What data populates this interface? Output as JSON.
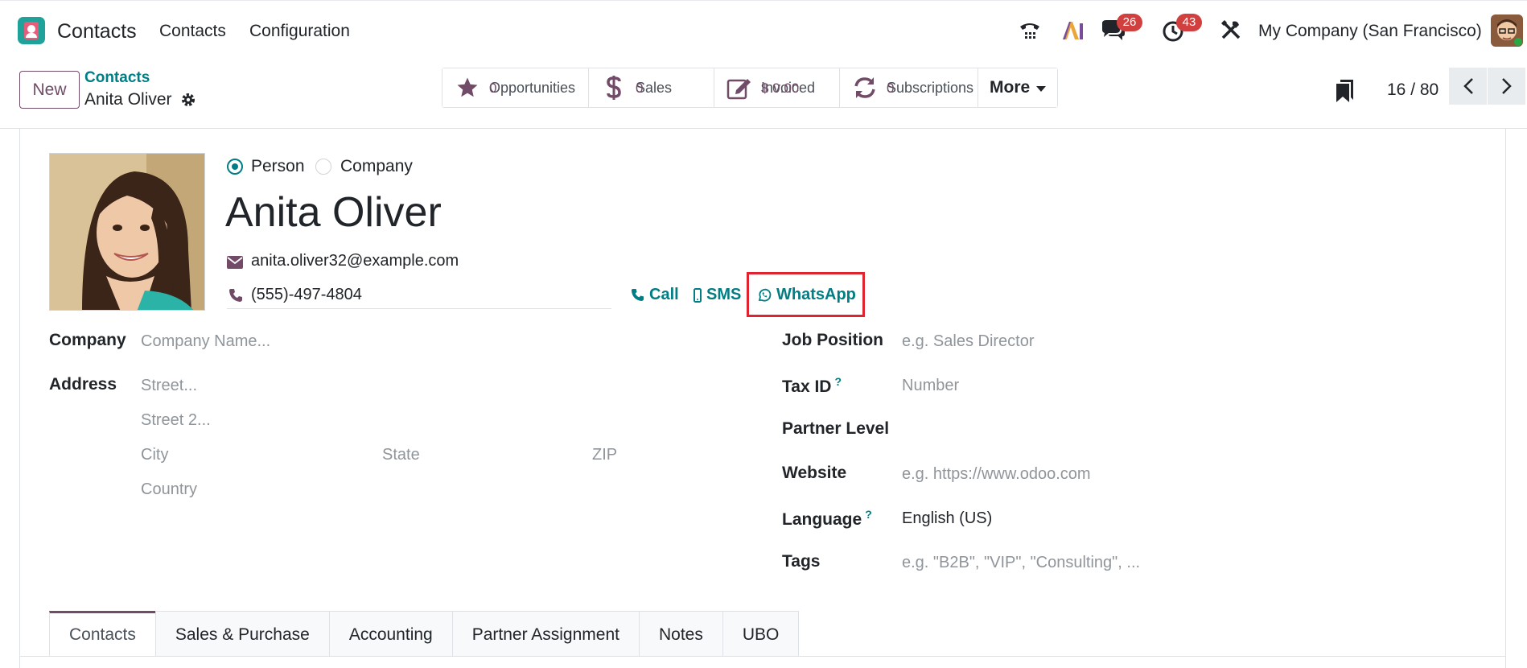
{
  "navbar": {
    "app_name": "Contacts",
    "menu": [
      "Contacts",
      "Configuration"
    ],
    "messages_count": "26",
    "activities_count": "43",
    "company": "My Company (San Francisco)"
  },
  "control": {
    "new_label": "New",
    "breadcrumb_parent": "Contacts",
    "breadcrumb_current": "Anita Oliver",
    "smart_buttons": [
      {
        "label": "Opportunities",
        "value": "0",
        "icon": "star-icon"
      },
      {
        "label": "Sales",
        "value": "0",
        "icon": "dollar-icon"
      },
      {
        "label": "Invoiced",
        "value": "$ 0.00",
        "icon": "edit-icon"
      },
      {
        "label": "Subscriptions",
        "value": "0",
        "icon": "refresh-icon"
      }
    ],
    "more_label": "More",
    "pager": "16 / 80"
  },
  "contact": {
    "type_person": "Person",
    "type_company": "Company",
    "name": "Anita Oliver",
    "email": "anita.oliver32@example.com",
    "phone": "(555)-497-4804",
    "call_label": "Call",
    "sms_label": "SMS",
    "whatsapp_label": "WhatsApp"
  },
  "left_fields": {
    "company_label": "Company",
    "company_placeholder": "Company Name...",
    "address_label": "Address",
    "street_placeholder": "Street...",
    "street2_placeholder": "Street 2...",
    "city_placeholder": "City",
    "state_placeholder": "State",
    "zip_placeholder": "ZIP",
    "country_placeholder": "Country"
  },
  "right_fields": {
    "job_label": "Job Position",
    "job_placeholder": "e.g. Sales Director",
    "tax_label": "Tax ID",
    "tax_placeholder": "Number",
    "partner_level_label": "Partner Level",
    "website_label": "Website",
    "website_placeholder": "e.g. https://www.odoo.com",
    "language_label": "Language",
    "language_value": "English (US)",
    "tags_label": "Tags",
    "tags_placeholder": "e.g. \"B2B\", \"VIP\", \"Consulting\", ...",
    "help_mark": "?"
  },
  "tabs": [
    "Contacts",
    "Sales & Purchase",
    "Accounting",
    "Partner Assignment",
    "Notes",
    "UBO"
  ],
  "colors": {
    "brand": "#714b67",
    "accent": "#017e84",
    "highlight": "#e0242f",
    "badge": "#d23f3f"
  }
}
